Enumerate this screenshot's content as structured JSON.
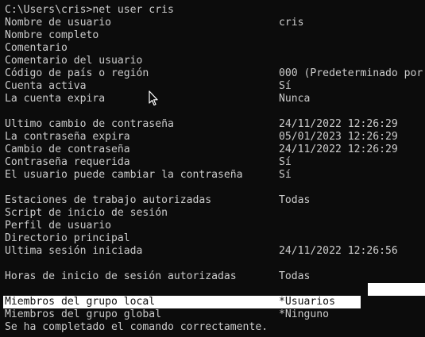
{
  "console": {
    "command_line": "C:\\Users\\cris>net user cris",
    "rows": [
      {
        "label": "Nombre de usuario",
        "value": "cris"
      },
      {
        "label": "Nombre completo",
        "value": ""
      },
      {
        "label": "Comentario",
        "value": ""
      },
      {
        "label": "Comentario del usuario",
        "value": ""
      },
      {
        "label": "Código de país o región",
        "value": "000 (Predeterminado por"
      },
      {
        "label": "Cuenta activa",
        "value": "Sí"
      },
      {
        "label": "La cuenta expira",
        "value": "Nunca"
      },
      {
        "label": "Ultimo cambio de contraseña",
        "value": "24/11/2022 12:26:29"
      },
      {
        "label": "La contraseña expira",
        "value": "05/01/2023 12:26:29"
      },
      {
        "label": "Cambio de contraseña",
        "value": "24/11/2022 12:26:29"
      },
      {
        "label": "Contraseña requerida",
        "value": "Sí"
      },
      {
        "label": "El usuario puede cambiar la contraseña",
        "value": "Sí"
      },
      {
        "label": "Estaciones de trabajo autorizadas",
        "value": "Todas"
      },
      {
        "label": "Script de inicio de sesión",
        "value": ""
      },
      {
        "label": "Perfil de usuario",
        "value": ""
      },
      {
        "label": "Directorio principal",
        "value": ""
      },
      {
        "label": "Ultima sesión iniciada",
        "value": "24/11/2022 12:26:56"
      },
      {
        "label": "Horas de inicio de sesión autorizadas",
        "value": "Todas"
      },
      {
        "label": "Miembros del grupo local",
        "value": "*Usuarios"
      },
      {
        "label": "Miembros del grupo global",
        "value": "*Ninguno"
      }
    ],
    "completion_message": "Se ha completado el comando correctamente."
  },
  "colors": {
    "background": "#0c0c0c",
    "foreground": "#cccccc",
    "selection": "#ffffff"
  },
  "icons": {
    "cursor": "mouse-pointer-icon"
  }
}
